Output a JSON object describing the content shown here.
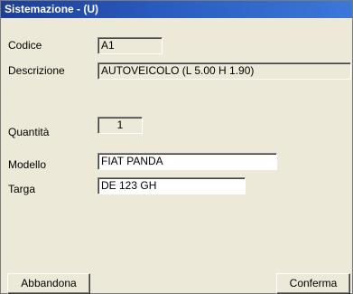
{
  "window": {
    "title": "Sistemazione - (U)"
  },
  "form": {
    "codice": {
      "label": "Codice",
      "value": "A1"
    },
    "descrizione": {
      "label": "Descrizione",
      "value": "AUTOVEICOLO (L 5.00 H 1.90)"
    },
    "quantita": {
      "label": "Quantità",
      "value": "1"
    },
    "modello": {
      "label": "Modello",
      "value": "FIAT PANDA"
    },
    "targa": {
      "label": "Targa",
      "value": "DE 123 GH"
    }
  },
  "buttons": {
    "abbandona": "Abbandona",
    "conferma": "Conferma"
  }
}
